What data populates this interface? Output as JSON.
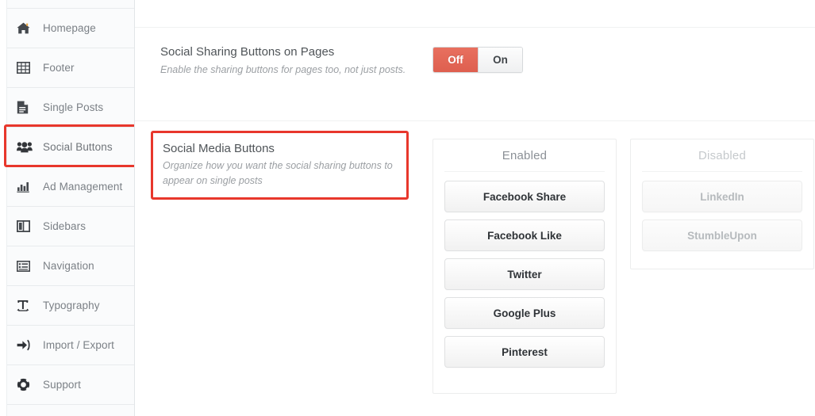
{
  "sidebar": {
    "items": [
      {
        "label": "",
        "icon": "partial-row",
        "active": false,
        "partial": true
      },
      {
        "label": "Homepage",
        "icon": "home-icon",
        "active": false
      },
      {
        "label": "Footer",
        "icon": "table-grid-icon",
        "active": false
      },
      {
        "label": "Single Posts",
        "icon": "document-icon",
        "active": false
      },
      {
        "label": "Social Buttons",
        "icon": "users-group-icon",
        "active": true
      },
      {
        "label": "Ad Management",
        "icon": "bar-chart-icon",
        "active": false
      },
      {
        "label": "Sidebars",
        "icon": "columns-icon",
        "active": false
      },
      {
        "label": "Navigation",
        "icon": "list-menu-icon",
        "active": false
      },
      {
        "label": "Typography",
        "icon": "text-height-icon",
        "active": false
      },
      {
        "label": "Import / Export",
        "icon": "sign-in-arrow-icon",
        "active": false
      },
      {
        "label": "Support",
        "icon": "lifebuoy-icon",
        "active": false
      }
    ]
  },
  "settings": {
    "social_sharing_pages": {
      "title": "Social Sharing Buttons on Pages",
      "description": "Enable the sharing buttons for pages too, not just posts.",
      "toggle": {
        "off_label": "Off",
        "on_label": "On",
        "selected": "Off"
      }
    },
    "social_media_buttons": {
      "title": "Social Media Buttons",
      "description": "Organize how you want the social sharing buttons to appear on single posts",
      "enabled": {
        "title": "Enabled",
        "items": [
          "Facebook Share",
          "Facebook Like",
          "Twitter",
          "Google Plus",
          "Pinterest"
        ]
      },
      "disabled": {
        "title": "Disabled",
        "items": [
          "LinkedIn",
          "StumbleUpon"
        ]
      }
    }
  },
  "colors": {
    "accent_red": "#e8372c",
    "toggle_active": "#de5f4f",
    "sidebar_bg": "#fafbfc",
    "text_muted": "#9b9fa3"
  }
}
